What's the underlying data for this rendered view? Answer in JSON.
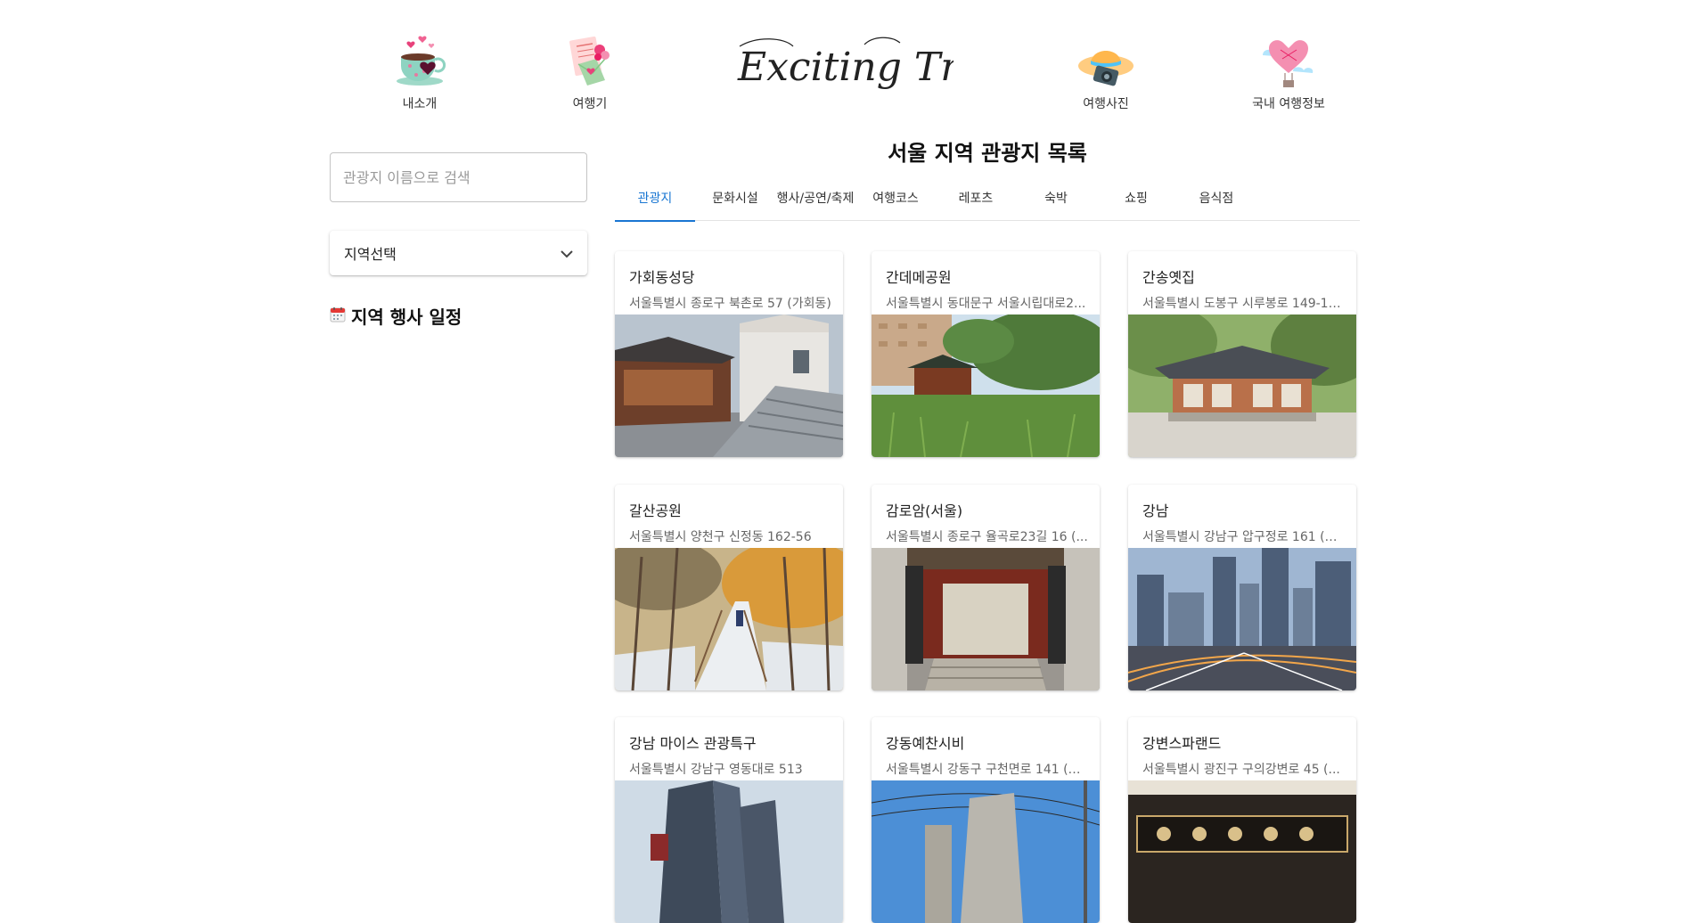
{
  "nav": {
    "about": {
      "label": "내소개",
      "icon": "teacup-heart-icon"
    },
    "travelogue": {
      "label": "여행기",
      "icon": "love-letter-icon"
    },
    "photos": {
      "label": "여행사진",
      "icon": "hat-camera-icon"
    },
    "info": {
      "label": "국내 여행정보",
      "icon": "heart-balloon-icon"
    },
    "logo_text": "Exciting Trip"
  },
  "sidebar": {
    "search_placeholder": "관광지 이름으로 검색",
    "region_select_label": "지역선택",
    "events_title": "지역 행사 일정",
    "events_icon": "calendar-icon"
  },
  "main": {
    "title": "서울 지역 관광지 목록",
    "tabs": [
      {
        "label": "관광지",
        "active": true
      },
      {
        "label": "문화시설"
      },
      {
        "label": "행사/공연/축제"
      },
      {
        "label": "여행코스"
      },
      {
        "label": "레포츠"
      },
      {
        "label": "숙박"
      },
      {
        "label": "쇼핑"
      },
      {
        "label": "음식점"
      }
    ],
    "cards": [
      {
        "title": "가회동성당",
        "address": "서울특별시 종로구 북촌로 57 (가회동)",
        "image": "hanok-cathedral-photo"
      },
      {
        "title": "간데메공원",
        "address": "서울특별시 동대문구 서울시립대로2...",
        "image": "park-pavilion-photo"
      },
      {
        "title": "간송옛집",
        "address": "서울특별시 도봉구 시루봉로 149-18...",
        "image": "traditional-house-photo"
      },
      {
        "title": "갈산공원",
        "address": "서울특별시 양천구 신정동 162-56",
        "image": "autumn-snow-path-photo"
      },
      {
        "title": "감로암(서울)",
        "address": "서울특별시 종로구 율곡로23길 16 (...",
        "image": "temple-gate-photo"
      },
      {
        "title": "강남",
        "address": "서울특별시 강남구 압구정로 161 (압...",
        "image": "gangnam-skyline-photo"
      },
      {
        "title": "강남 마이스 관광특구",
        "address": "서울특별시 강남구 영동대로 513",
        "image": "office-towers-photo"
      },
      {
        "title": "강동예찬시비",
        "address": "서울특별시 강동구 구천면로 141 (천...",
        "image": "stone-monument-photo"
      },
      {
        "title": "강변스파랜드",
        "address": "서울특별시 광진구 구의강변로 45 (...",
        "image": "spa-sign-photo"
      }
    ]
  },
  "colors": {
    "accent": "#1976d2",
    "tab_text": "#333333",
    "address_text": "#666666"
  }
}
